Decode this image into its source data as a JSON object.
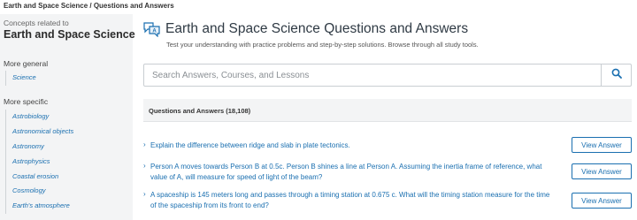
{
  "breadcrumb": "Earth and Space Science / Questions and Answers",
  "sidebar": {
    "caption": "Concepts related to",
    "title": "Earth and Space Science",
    "general_heading": "More general",
    "general_items": [
      "Science"
    ],
    "specific_heading": "More specific",
    "specific_items": [
      "Astrobiology",
      "Astronomical objects",
      "Astronomy",
      "Astrophysics",
      "Coastal erosion",
      "Cosmology",
      "Earth's atmosphere"
    ]
  },
  "header": {
    "icon": "qa-chat-icon",
    "title": "Earth and Space Science Questions and Answers",
    "subtitle": "Test your understanding with practice problems and step-by-step solutions. Browse through all study tools."
  },
  "search": {
    "placeholder": "Search Answers, Courses, and Lessons",
    "icon": "search-icon"
  },
  "qa": {
    "heading": "Questions and Answers (18,108)",
    "button_label": "View Answer",
    "questions": [
      "Explain the difference between ridge and slab in plate tectonics.",
      "Person A moves towards Person B at 0.5c. Person B shines a line at Person A. Assuming the inertia frame of reference, what value of A, will measure for speed of light of the beam?",
      "A spaceship is 145 meters long and passes through a timing station at 0.675 c. What will the timing station measure for the time of the spaceship from its front to end?"
    ]
  },
  "colors": {
    "accent": "#1a6fb0",
    "sidebar_bg": "#f3f4f5"
  }
}
